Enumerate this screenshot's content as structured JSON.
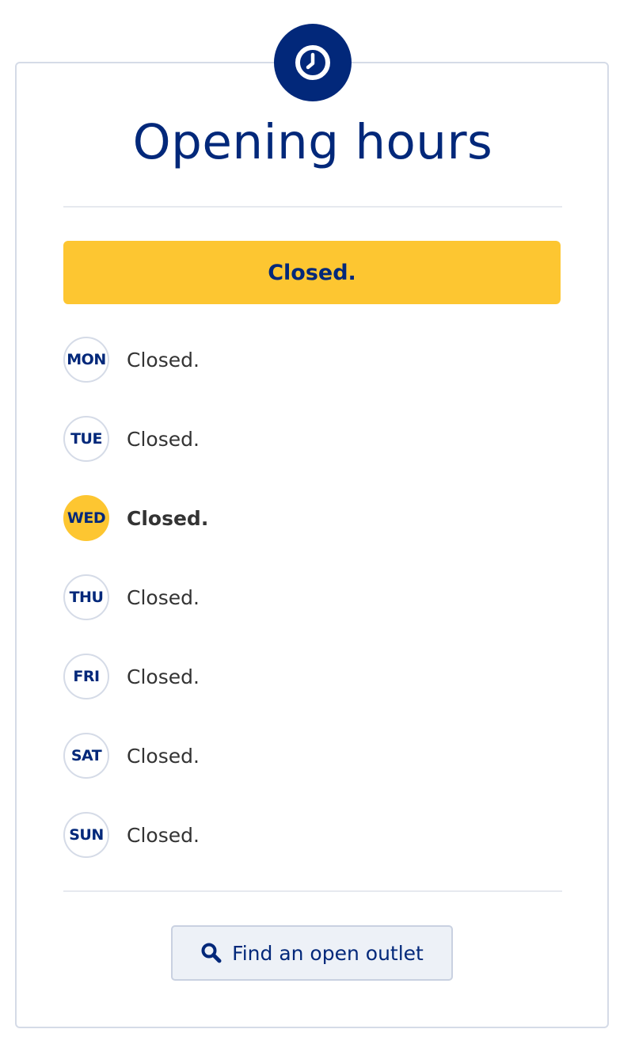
{
  "header": {
    "title": "Opening hours",
    "icon": "clock-icon"
  },
  "status": {
    "label": "Closed."
  },
  "days": [
    {
      "day": "MON",
      "status": "Closed.",
      "today": false
    },
    {
      "day": "TUE",
      "status": "Closed.",
      "today": false
    },
    {
      "day": "WED",
      "status": "Closed.",
      "today": true
    },
    {
      "day": "THU",
      "status": "Closed.",
      "today": false
    },
    {
      "day": "FRI",
      "status": "Closed.",
      "today": false
    },
    {
      "day": "SAT",
      "status": "Closed.",
      "today": false
    },
    {
      "day": "SUN",
      "status": "Closed.",
      "today": false
    }
  ],
  "action": {
    "label": "Find an open outlet",
    "icon": "search-icon"
  },
  "colors": {
    "brand_navy": "#02287a",
    "accent_yellow": "#fdc631",
    "border": "#d5dbe7"
  }
}
